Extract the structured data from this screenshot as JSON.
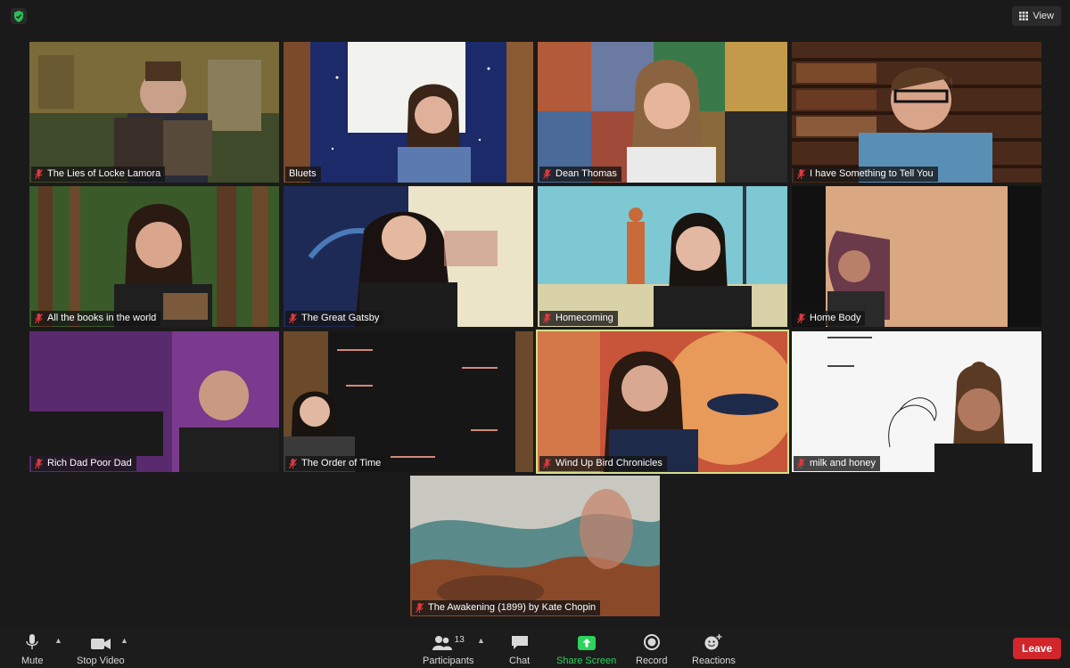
{
  "window": {
    "view_label": "View"
  },
  "tiles": [
    {
      "name": "The Lies of Locke Lamora",
      "muted": true
    },
    {
      "name": "Bluets",
      "muted": false
    },
    {
      "name": "Dean Thomas",
      "muted": true
    },
    {
      "name": "I have Something to Tell You",
      "muted": true
    },
    {
      "name": "All the books in the world",
      "muted": true
    },
    {
      "name": "The Great Gatsby",
      "muted": true
    },
    {
      "name": "Homecoming",
      "muted": true
    },
    {
      "name": "Home Body",
      "muted": true
    },
    {
      "name": "Rich Dad Poor Dad",
      "muted": true
    },
    {
      "name": "The Order of Time",
      "muted": true
    },
    {
      "name": "Wind Up Bird Chronicles",
      "muted": true,
      "active": true
    },
    {
      "name": "milk and honey",
      "muted": true
    },
    {
      "name": "The Awakening (1899) by Kate Chopin",
      "muted": true
    }
  ],
  "toolbar": {
    "mute": "Mute",
    "stop_video": "Stop Video",
    "participants": "Participants",
    "participants_count": "13",
    "chat": "Chat",
    "share_screen": "Share Screen",
    "record": "Record",
    "reactions": "Reactions",
    "leave": "Leave"
  },
  "colors": {
    "accent_green": "#2dd35b",
    "leave_red": "#d0262c",
    "active_speaker_border": "#d4e08a",
    "muted_icon_red": "#e0383e"
  },
  "icons": [
    "shield-check-icon",
    "grid-view-icon",
    "microphone-icon",
    "video-camera-icon",
    "participants-icon",
    "chat-icon",
    "share-screen-icon",
    "record-icon",
    "reactions-icon",
    "mic-muted-icon"
  ]
}
